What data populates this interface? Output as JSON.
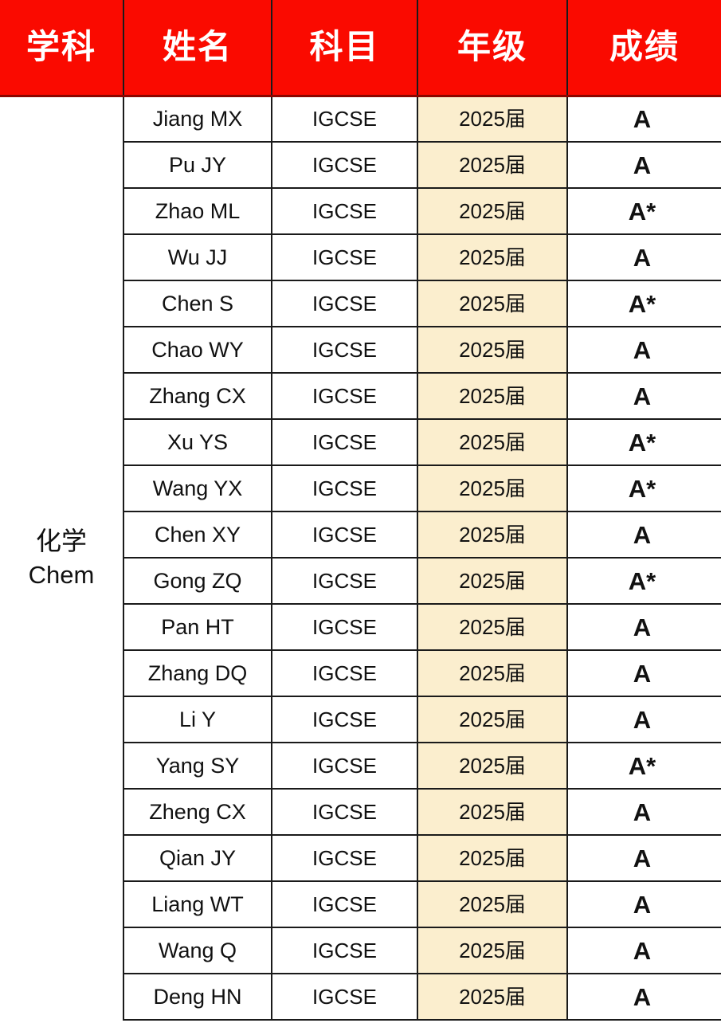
{
  "table": {
    "headers": [
      {
        "key": "subject",
        "label": "学科"
      },
      {
        "key": "name",
        "label": "姓名"
      },
      {
        "key": "exam",
        "label": "科目"
      },
      {
        "key": "year",
        "label": "年级"
      },
      {
        "key": "grade",
        "label": "成绩"
      }
    ],
    "subject_group": {
      "name_cn": "化学",
      "name_en": "Chem"
    },
    "rows": [
      {
        "name": "Jiang MX",
        "exam": "IGCSE",
        "year": "2025届",
        "grade": "A"
      },
      {
        "name": "Pu JY",
        "exam": "IGCSE",
        "year": "2025届",
        "grade": "A"
      },
      {
        "name": "Zhao ML",
        "exam": "IGCSE",
        "year": "2025届",
        "grade": "A*"
      },
      {
        "name": "Wu JJ",
        "exam": "IGCSE",
        "year": "2025届",
        "grade": "A"
      },
      {
        "name": "Chen S",
        "exam": "IGCSE",
        "year": "2025届",
        "grade": "A*"
      },
      {
        "name": "Chao WY",
        "exam": "IGCSE",
        "year": "2025届",
        "grade": "A"
      },
      {
        "name": "Zhang CX",
        "exam": "IGCSE",
        "year": "2025届",
        "grade": "A"
      },
      {
        "name": "Xu YS",
        "exam": "IGCSE",
        "year": "2025届",
        "grade": "A*"
      },
      {
        "name": "Wang YX",
        "exam": "IGCSE",
        "year": "2025届",
        "grade": "A*"
      },
      {
        "name": "Chen XY",
        "exam": "IGCSE",
        "year": "2025届",
        "grade": "A"
      },
      {
        "name": "Gong ZQ",
        "exam": "IGCSE",
        "year": "2025届",
        "grade": "A*"
      },
      {
        "name": "Pan HT",
        "exam": "IGCSE",
        "year": "2025届",
        "grade": "A"
      },
      {
        "name": "Zhang DQ",
        "exam": "IGCSE",
        "year": "2025届",
        "grade": "A"
      },
      {
        "name": "Li Y",
        "exam": "IGCSE",
        "year": "2025届",
        "grade": "A"
      },
      {
        "name": "Yang SY",
        "exam": "IGCSE",
        "year": "2025届",
        "grade": "A*"
      },
      {
        "name": "Zheng CX",
        "exam": "IGCSE",
        "year": "2025届",
        "grade": "A"
      },
      {
        "name": "Qian JY",
        "exam": "IGCSE",
        "year": "2025届",
        "grade": "A"
      },
      {
        "name": "Liang WT",
        "exam": "IGCSE",
        "year": "2025届",
        "grade": "A"
      },
      {
        "name": "Wang Q",
        "exam": "IGCSE",
        "year": "2025届",
        "grade": "A"
      },
      {
        "name": "Deng HN",
        "exam": "IGCSE",
        "year": "2025届",
        "grade": "A"
      }
    ]
  },
  "colors": {
    "header_background": "#fa0a00",
    "header_text": "#ffffff",
    "year_column_background": "#fbeece",
    "cell_background": "#ffffff",
    "grid_line": "#1a1a1a",
    "text": "#111111"
  }
}
